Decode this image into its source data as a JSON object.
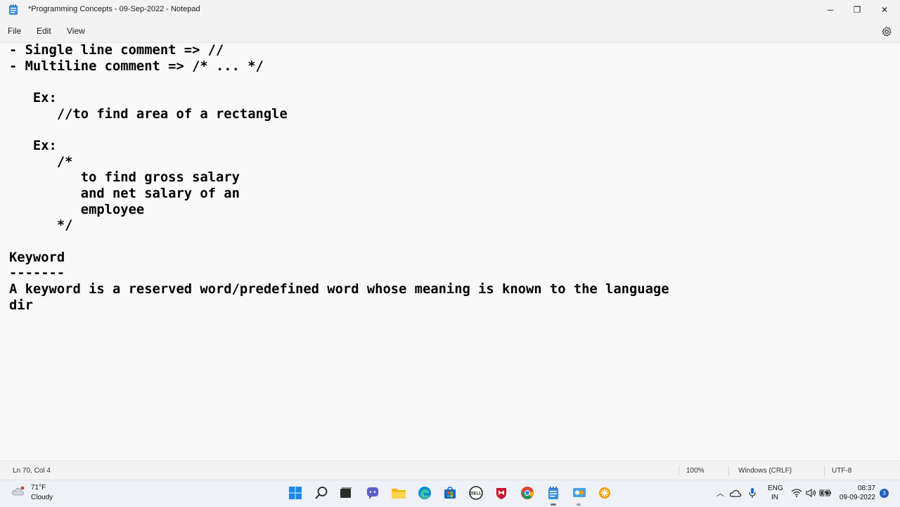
{
  "window": {
    "title": "*Programming Concepts - 09-Sep-2022 - Notepad",
    "minimize_label": "─",
    "maximize_label": "❐",
    "close_label": "✕"
  },
  "menu": {
    "file": "File",
    "edit": "Edit",
    "view": "View"
  },
  "editor": {
    "content": "- Single line comment => //\n- Multiline comment => /* ... */\n\n   Ex:\n      //to find area of a rectangle\n\n   Ex:\n      /*\n         to find gross salary\n         and net salary of an\n         employee\n      */\n\nKeyword\n-------\nA keyword is a reserved word/predefined word whose meaning is known to the language\ndir"
  },
  "status": {
    "position": "Ln 70, Col 4",
    "zoom": "100%",
    "line_ending": "Windows (CRLF)",
    "encoding": "UTF-8"
  },
  "taskbar": {
    "weather_temp": "71°F",
    "weather_desc": "Cloudy",
    "lang_top": "ENG",
    "lang_bottom": "IN",
    "time": "08:37",
    "date": "09-09-2022",
    "notification_count": "3"
  },
  "colors": {
    "accent": "#0078d4"
  }
}
